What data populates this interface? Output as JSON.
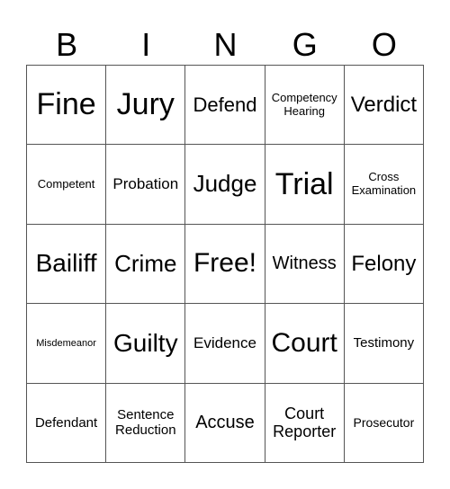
{
  "header": [
    "B",
    "I",
    "N",
    "G",
    "O"
  ],
  "cells": [
    "Fine",
    "Jury",
    "Defend",
    "Competency\nHearing",
    "Verdict",
    "Competent",
    "Probation",
    "Judge",
    "Trial",
    "Cross\nExamination",
    "Bailiff",
    "Crime",
    "Free!",
    "Witness",
    "Felony",
    "Misdemeanor",
    "Guilty",
    "Evidence",
    "Court",
    "Testimony",
    "Defendant",
    "Sentence\nReduction",
    "Accuse",
    "Court\nReporter",
    "Prosecutor"
  ]
}
